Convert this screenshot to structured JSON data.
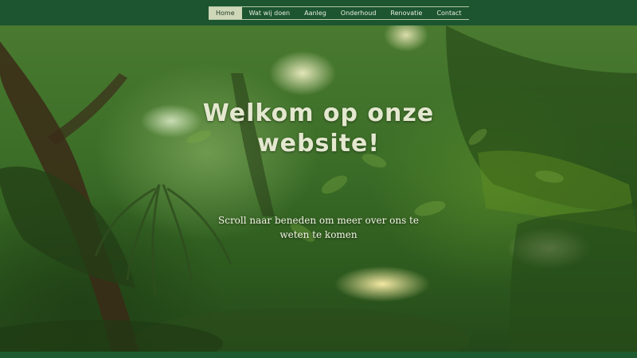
{
  "nav": {
    "items": [
      {
        "label": "Home",
        "active": true
      },
      {
        "label": "Wat wij doen",
        "active": false
      },
      {
        "label": "Aanleg",
        "active": false
      },
      {
        "label": "Onderhoud",
        "active": false
      },
      {
        "label": "Renovatie",
        "active": false
      },
      {
        "label": "Contact",
        "active": false
      }
    ]
  },
  "hero": {
    "title": "Welkom op onze website!",
    "subtitle": "Scroll naar beneden om meer over ons te weten te komen"
  },
  "colors": {
    "header_bg": "#1c5530",
    "nav_active_bg": "#cfd7b9",
    "title_color": "#e4e8cf",
    "subtitle_color": "#f4f4e6"
  }
}
